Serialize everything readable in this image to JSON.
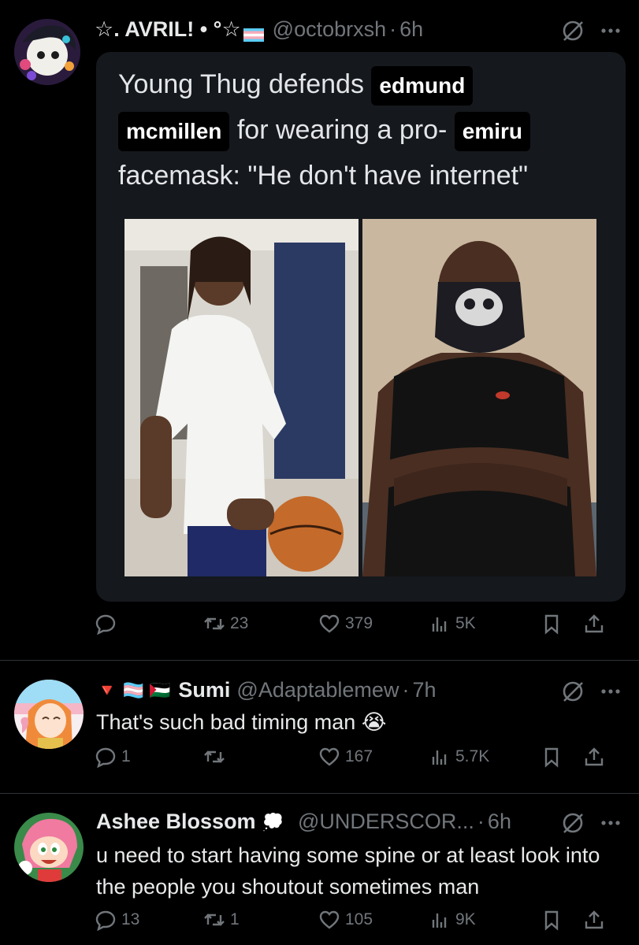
{
  "tweet1": {
    "display_name": "☆. AVRIL! • °☆",
    "handle": "@octobrxsh",
    "dot": "·",
    "time": "6h",
    "media": {
      "headline_part1": "Young Thug defends",
      "chip1": "edmund",
      "chip2": "mcmillen",
      "headline_part2": "for wearing a pro-",
      "chip3": "emiru",
      "headline_part3": "facemask: \"He don't have internet\""
    },
    "actions": {
      "replies": "",
      "reposts": "23",
      "likes": "379",
      "views": "5K"
    }
  },
  "tweet2": {
    "flags": "🔻 🏳️‍⚧️ 🇵🇸",
    "display_name": "Sumi",
    "handle": "@Adaptablemew",
    "dot": "·",
    "time": "7h",
    "text": "That's such bad timing man 😭",
    "actions": {
      "replies": "1",
      "reposts": "",
      "likes": "167",
      "views": "5.7K"
    }
  },
  "tweet3": {
    "display_name": "Ashee Blossom",
    "badge": "💭",
    "handle": "@UNDERSCOR...",
    "dot": "·",
    "time": "6h",
    "text": "u need to start having some spine or at least look into the people you shoutout sometimes man",
    "actions": {
      "replies": "13",
      "reposts": "1",
      "likes": "105",
      "views": "9K"
    }
  },
  "colors": {
    "background": "#000000",
    "text": "#e7e9ea",
    "muted": "#71767b",
    "divider": "#2f3336",
    "card": "#15181c"
  },
  "icons": [
    "reply-icon",
    "repost-icon",
    "like-icon",
    "views-icon",
    "bookmark-icon",
    "share-icon",
    "grok-icon",
    "more-icon"
  ]
}
